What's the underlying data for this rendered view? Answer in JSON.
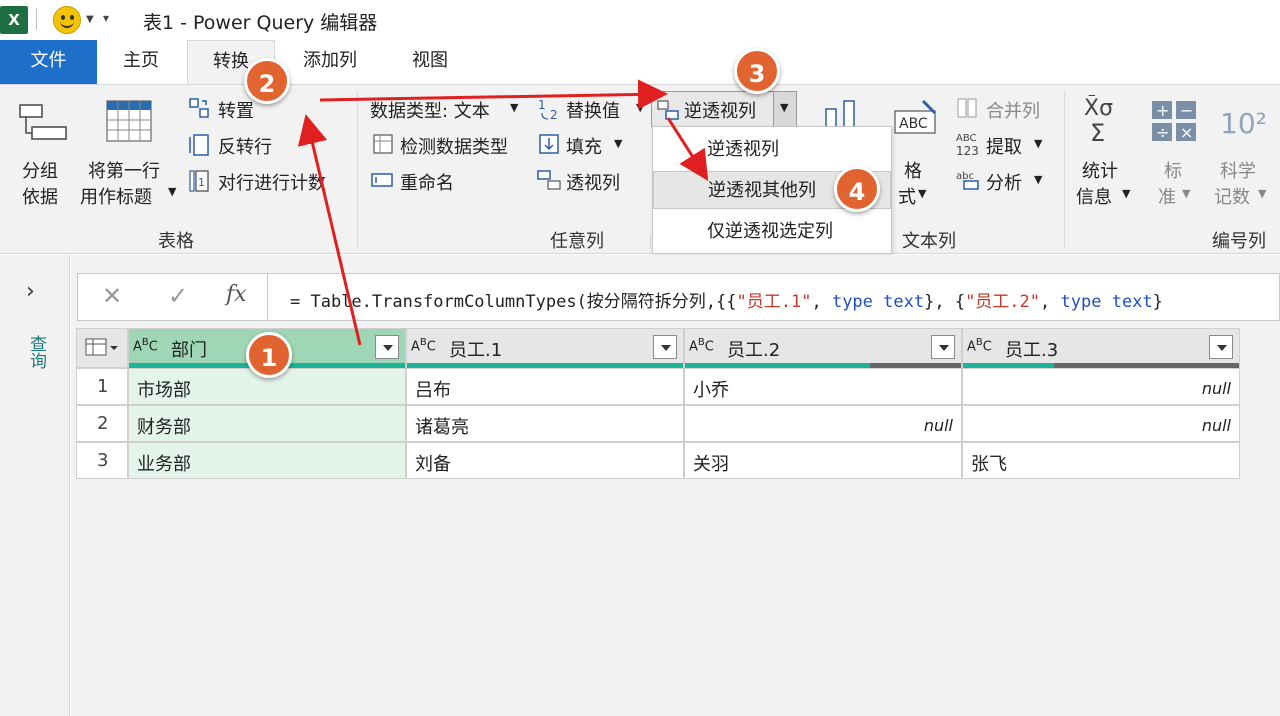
{
  "titlebar": {
    "app_icon": "X",
    "title": "表1 - Power Query 编辑器"
  },
  "tabs": {
    "file": "文件",
    "home": "主页",
    "transform": "转换",
    "add_column": "添加列",
    "view": "视图"
  },
  "ribbon": {
    "table_group": {
      "label": "表格",
      "group_by_line1": "分组",
      "group_by_line2": "依据",
      "first_row_line1": "将第一行",
      "first_row_line2": "用作标题",
      "transpose": "转置",
      "reverse_rows": "反转行",
      "count_rows": "对行进行计数"
    },
    "any_column_group": {
      "label": "任意列",
      "data_type": "数据类型: 文本",
      "detect_type": "检测数据类型",
      "rename": "重命名",
      "replace_values": "替换值",
      "fill": "填充",
      "pivot_column": "透视列",
      "unpivot_columns": "逆透视列"
    },
    "text_column_group": {
      "label": "文本列",
      "format_line1": "格",
      "format_line2": "式",
      "merge_columns": "合并列",
      "extract": "提取",
      "parse": "分析"
    },
    "number_column_group": {
      "label": "编号列",
      "statistics_line1": "统计",
      "statistics_line2": "信息",
      "standard_line1": "标",
      "standard_line2": "准",
      "scientific_line1": "科学",
      "scientific_line2": "记数",
      "scientific_icon": "10²"
    }
  },
  "unpivot_menu": {
    "items": [
      "逆透视列",
      "逆透视其他列",
      "仅逆透视选定列"
    ],
    "highlighted_index": 1
  },
  "leftnav": {
    "label": "查询"
  },
  "formula_bar": {
    "cancel_glyph": "✕",
    "confirm_glyph": "✓",
    "fx": "fx",
    "parts": [
      {
        "t": "= Table.TransformColumnTypes(按分隔符拆分列,{{",
        "c": "plain"
      },
      {
        "t": "\"员工.1\"",
        "c": "str"
      },
      {
        "t": ", ",
        "c": "plain"
      },
      {
        "t": "type",
        "c": "kw"
      },
      {
        "t": " ",
        "c": "plain"
      },
      {
        "t": "text",
        "c": "kw"
      },
      {
        "t": "}, {",
        "c": "plain"
      },
      {
        "t": "\"员工.2\"",
        "c": "str"
      },
      {
        "t": ", ",
        "c": "plain"
      },
      {
        "t": "type",
        "c": "kw"
      },
      {
        "t": " ",
        "c": "plain"
      },
      {
        "t": "text",
        "c": "kw"
      },
      {
        "t": "}",
        "c": "plain"
      }
    ]
  },
  "table": {
    "type_prefix": "ABC",
    "columns": [
      "部门",
      "员工.1",
      "员工.2",
      "员工.3"
    ],
    "selected_column": 0,
    "rows": [
      {
        "num": "1",
        "cells": [
          "市场部",
          "吕布",
          "小乔",
          "null"
        ]
      },
      {
        "num": "2",
        "cells": [
          "财务部",
          "诸葛亮",
          "null",
          "null"
        ]
      },
      {
        "num": "3",
        "cells": [
          "业务部",
          "刘备",
          "关羽",
          "张飞"
        ]
      }
    ],
    "quality_fill": [
      1.0,
      1.0,
      0.67,
      0.33
    ]
  },
  "callouts": [
    "1",
    "2",
    "3",
    "4"
  ],
  "colors": {
    "accent": "#1e6fc9",
    "callout": "#e1632f",
    "arrow": "#e02020",
    "selected_header": "#9fd6b5",
    "selected_cell": "#e4f4ea",
    "quality_valid": "#1db39a",
    "quality_empty": "#666666"
  }
}
